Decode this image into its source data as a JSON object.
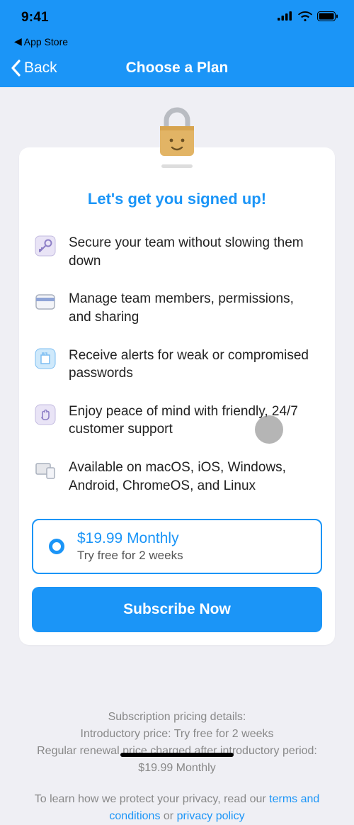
{
  "status": {
    "time": "9:41",
    "breadcrumb": "App Store"
  },
  "nav": {
    "back": "Back",
    "title": "Choose a Plan"
  },
  "card": {
    "heading": "Let's get you signed up!",
    "features": [
      "Secure your team without slowing them down",
      "Manage team members, permissions, and sharing",
      "Receive alerts for weak or compromised passwords",
      "Enjoy peace of mind with friendly, 24/7 customer support",
      "Available on macOS, iOS, Windows, Android, ChromeOS, and Linux"
    ]
  },
  "plan": {
    "price": "$19.99 Monthly",
    "trial": "Try free for 2 weeks"
  },
  "cta": "Subscribe Now",
  "details": {
    "l1": "Subscription pricing details:",
    "l2": "Introductory price: Try free for 2 weeks",
    "l3": "Regular renewal price charged after introductory period: $19.99 Monthly"
  },
  "legal": {
    "pre": "To learn how we protect your privacy, read our ",
    "terms": "terms and conditions",
    "mid": " or ",
    "privacy": "privacy policy"
  }
}
